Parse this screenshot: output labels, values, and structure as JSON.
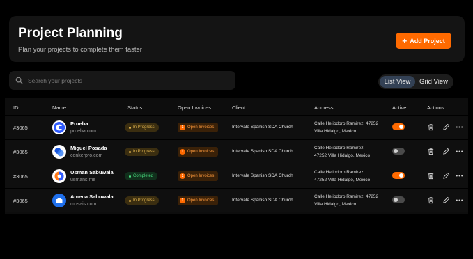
{
  "header": {
    "title": "Project Planning",
    "subtitle": "Plan your projects to complete them faster",
    "add_button_label": "Add Project"
  },
  "search": {
    "placeholder": "Search your projects",
    "value": ""
  },
  "view_toggle": {
    "list_label": "List View",
    "grid_label": "Grid View",
    "selected": "List View"
  },
  "colors": {
    "accent": "#ff6a00",
    "background": "#000000",
    "card": "#141414",
    "in_progress": "#d9a441",
    "completed": "#34c759"
  },
  "table": {
    "columns": {
      "id": "ID",
      "name": "Name",
      "status": "Status",
      "open_invoices": "Open Invoices",
      "client": "Client",
      "address": "Address",
      "active": "Active",
      "actions": "Actions"
    },
    "rows": [
      {
        "id": "#3065",
        "name": "Prueba",
        "site": "prueba.com",
        "avatar_icon": "c-logo-icon",
        "status": "In Progress",
        "invoice_count": "1",
        "invoice_label": "Open Invoices",
        "client": "Intervale Spanish SDA Church",
        "address_line1": "Calle Heliodoro Ramirez, 47252",
        "address_line2": "Villa Hidalgo, Mexico",
        "active": true
      },
      {
        "id": "#3065",
        "name": "Miguel Posada",
        "site": "conkerpro.com",
        "avatar_icon": "blue-circles-icon",
        "status": "In Progress",
        "invoice_count": "1",
        "invoice_label": "Open Invoices",
        "client": "Intervale Spanish SDA Church",
        "address_line1": "Calle Heliodoro Ramirez,",
        "address_line2": "47252 Villa Hidalgo, Mexico",
        "active": false
      },
      {
        "id": "#3065",
        "name": "Usman Sabuwala",
        "site": "usmans.me",
        "avatar_icon": "orange-half-icon",
        "status": "Completed",
        "invoice_count": "1",
        "invoice_label": "Open Invoices",
        "client": "Intervale Spanish SDA Church",
        "address_line1": "Calle Heliodoro Ramirez,",
        "address_line2": "47252 Villa Hidalgo, Mexico",
        "active": true
      },
      {
        "id": "#3065",
        "name": "Amena Sabuwala",
        "site": "musais.com",
        "avatar_icon": "blue-tile-icon",
        "status": "In Progress",
        "invoice_count": "1",
        "invoice_label": "Open Invoices",
        "client": "Intervale Spanish SDA Church",
        "address_line1": "Calle Heliodoro Ramirez, 47252",
        "address_line2": "Villa Hidalgo, Mexico",
        "active": false
      }
    ]
  }
}
